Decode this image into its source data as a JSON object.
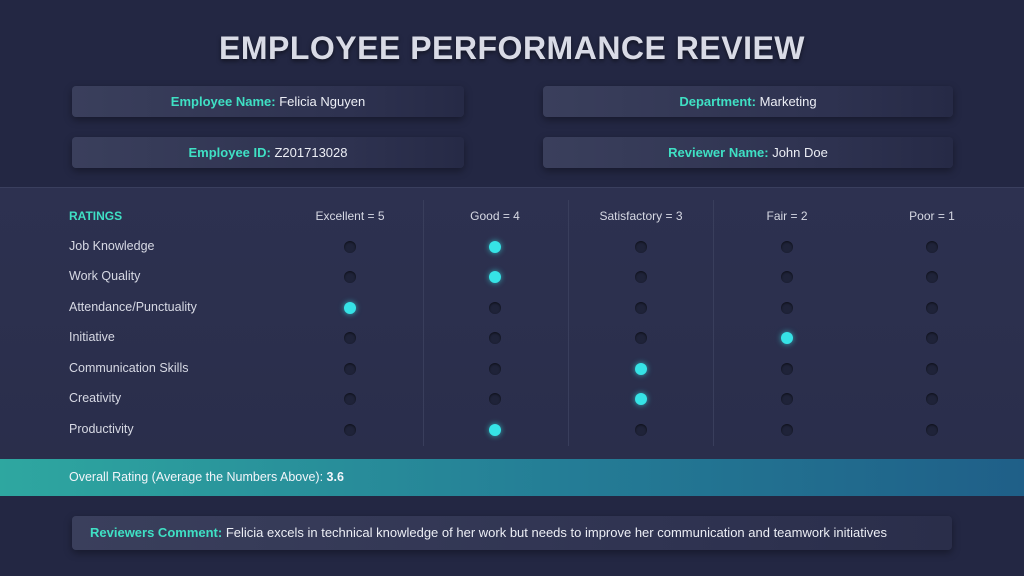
{
  "title": "EMPLOYEE PERFORMANCE REVIEW",
  "info": {
    "employee_name_label": "Employee Name:",
    "employee_name": "Felicia Nguyen",
    "department_label": "Department:",
    "department": "Marketing",
    "employee_id_label": "Employee ID:",
    "employee_id": "Z201713028",
    "reviewer_label": "Reviewer Name:",
    "reviewer": "John Doe"
  },
  "ratings": {
    "header": "RATINGS",
    "scale": [
      "Excellent = 5",
      "Good = 4",
      "Satisfactory = 3",
      "Fair = 2",
      "Poor = 1"
    ],
    "criteria": [
      {
        "label": "Job Knowledge",
        "score": 4
      },
      {
        "label": "Work Quality",
        "score": 4
      },
      {
        "label": "Attendance/Punctuality",
        "score": 5
      },
      {
        "label": "Initiative",
        "score": 2
      },
      {
        "label": "Communication Skills",
        "score": 3
      },
      {
        "label": "Creativity",
        "score": 3
      },
      {
        "label": "Productivity",
        "score": 4
      }
    ]
  },
  "overall": {
    "label": "Overall Rating (Average the Numbers Above):",
    "value": "3.6"
  },
  "comment": {
    "label": "Reviewers Comment:",
    "text": "Felicia excels in technical knowledge of her work but needs to improve her communication and teamwork initiatives"
  },
  "colors": {
    "accent": "#3fe0c4",
    "selected_dot": "#36e3e6",
    "background": "#232743"
  }
}
